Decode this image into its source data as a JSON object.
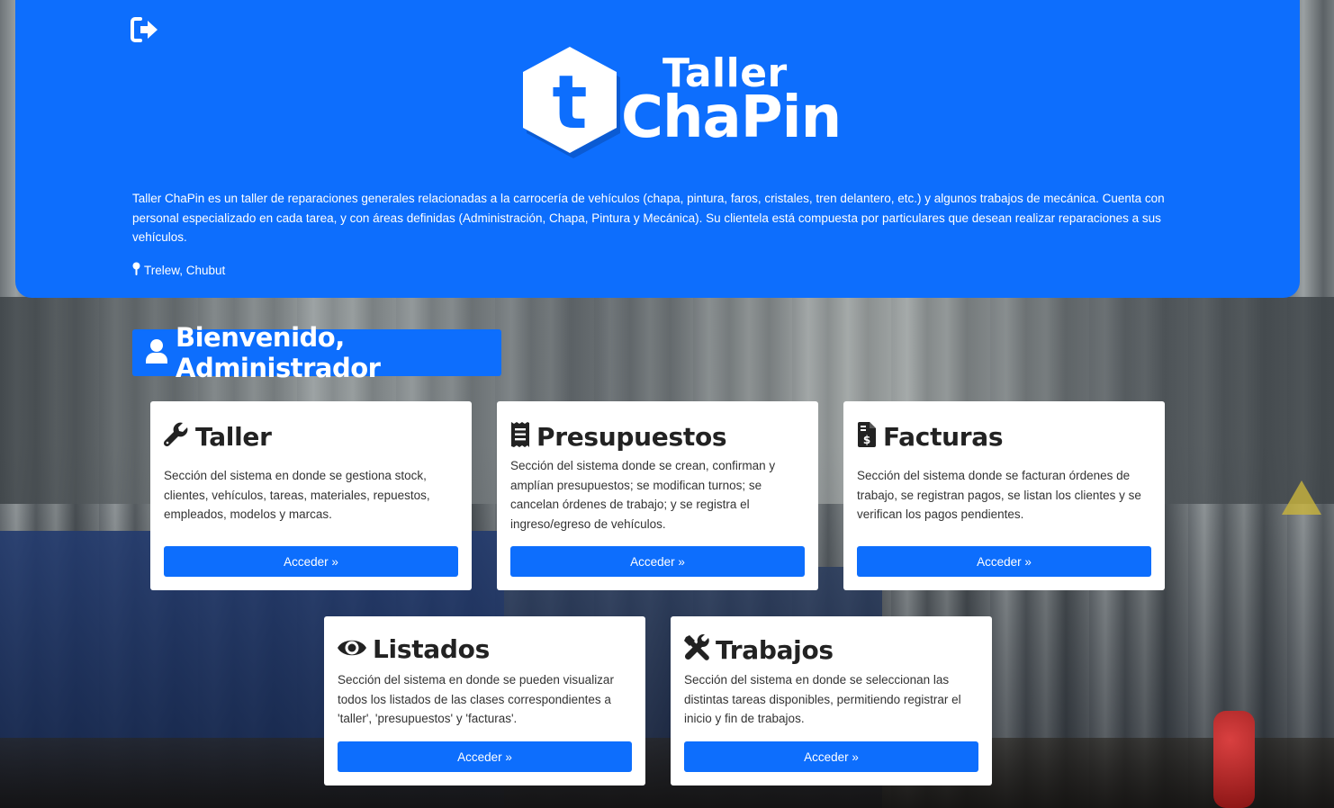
{
  "header": {
    "logo_line1": "Taller",
    "logo_line2": "ChaPin",
    "logo_letter": "t",
    "description": "Taller ChaPin es un taller de reparaciones generales relacionadas a la carrocería de vehículos (chapa, pintura, faros, cristales, tren delantero, etc.) y algunos trabajos de mecánica. Cuenta con personal especializado en cada tarea, y con áreas definidas (Administración, Chapa, Pintura y Mecánica). Su clientela está compuesta por particulares que desean realizar reparaciones a sus vehículos.",
    "location": "Trelew, Chubut",
    "logout_icon": "sign-out-icon"
  },
  "welcome": {
    "text": "Bienvenido, Administrador",
    "icon": "user-icon"
  },
  "cards": [
    {
      "title": "Taller",
      "icon": "wrench-icon",
      "text": "Sección del sistema en donde se gestiona stock, clientes, vehículos, tareas, materiales, repuestos, empleados, modelos y marcas.",
      "button": "Acceder »"
    },
    {
      "title": "Presupuestos",
      "icon": "receipt-icon",
      "text": "Sección del sistema donde se crean, confirman y amplían presupuestos; se modifican turnos; se cancelan órdenes de trabajo; y se registra el ingreso/egreso de vehículos.",
      "button": "Acceder »"
    },
    {
      "title": "Facturas",
      "icon": "invoice-dollar-icon",
      "text": "Sección del sistema donde se facturan órdenes de trabajo, se registran pagos, se listan los clientes y se verifican los pagos pendientes.",
      "button": "Acceder »"
    },
    {
      "title": "Listados",
      "icon": "eye-icon",
      "text": "Sección del sistema en donde se pueden visualizar todos los listados de las clases correspondientes a 'taller', 'presupuestos' y 'facturas'.",
      "button": "Acceder »"
    },
    {
      "title": "Trabajos",
      "icon": "tools-icon",
      "text": "Sección del sistema en donde se seleccionan las distintas tareas disponibles, permitiendo registrar el inicio y fin de trabajos.",
      "button": "Acceder »"
    }
  ],
  "colors": {
    "primary": "#0d6efd",
    "card_bg": "#ffffff",
    "text_dark": "#222222"
  }
}
